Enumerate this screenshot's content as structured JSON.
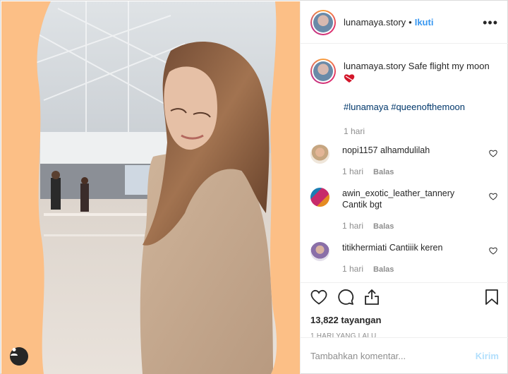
{
  "post": {
    "username": "lunamaya.story",
    "follow_label": "Ikuti",
    "dot": "•",
    "more_icon": "more-options-icon",
    "caption_text": "Safe flight my moon",
    "hashtags": "#lunamaya #queenofthemoon",
    "caption_time": "1 hari"
  },
  "comments": [
    {
      "username": "nopi1157",
      "text": "alhamdulilah",
      "time": "1 hari",
      "reply": "Balas",
      "avatar_color": "#e7d5c0"
    },
    {
      "username": "awin_exotic_leather_tannery",
      "text": "Cantik bgt",
      "time": "1 hari",
      "reply": "Balas",
      "avatar_color": "#b0406a"
    },
    {
      "username": "titikhermiati",
      "text": "Cantiiik keren",
      "time": "1 hari",
      "reply": "Balas",
      "avatar_color": "#8a6fa8"
    }
  ],
  "actions": {
    "views": "13,822 tayangan",
    "posted": "1 HARI YANG LALU"
  },
  "composer": {
    "placeholder": "Tambahkan komentar...",
    "post_label": "Kirim"
  },
  "colors": {
    "media_background": "#fcbf86",
    "link_blue": "#3897f0",
    "hashtag_blue": "#00376b",
    "muted": "#8e8e8e"
  }
}
